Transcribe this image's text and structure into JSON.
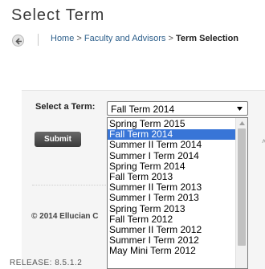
{
  "page": {
    "title": "Select Term"
  },
  "breadcrumb": {
    "items": [
      "Home",
      "Faculty and Advisors",
      "Term Selection"
    ],
    "separator": ">"
  },
  "form": {
    "select_label": "Select a Term:",
    "selected_value": "Fall Term 2014",
    "submit_label": "Submit",
    "options": [
      "Spring Term 2015",
      "Fall Term 2014",
      "Summer II Term 2014",
      "Summer I Term 2014",
      "Spring Term 2014",
      "Fall Term 2013",
      "Summer II Term 2013",
      "Summer I Term 2013",
      "Spring Term 2013",
      "Fall Term 2012",
      "Summer II Term 2012",
      "Summer I Term 2012",
      "May Mini Term 2012"
    ],
    "highlighted_option": "Fall Term 2014"
  },
  "footer": {
    "copyright": "© 2014 Ellucian C",
    "release": "RELEASE: 8.5.1.2"
  },
  "colors": {
    "highlight": "#3875d7",
    "link": "#2d5f8b",
    "button": "#4a4a4a"
  },
  "icons": {
    "back": "back-arrow-icon",
    "dropdown": "chevron-down-icon",
    "scroll_up": "scroll-up-icon"
  }
}
